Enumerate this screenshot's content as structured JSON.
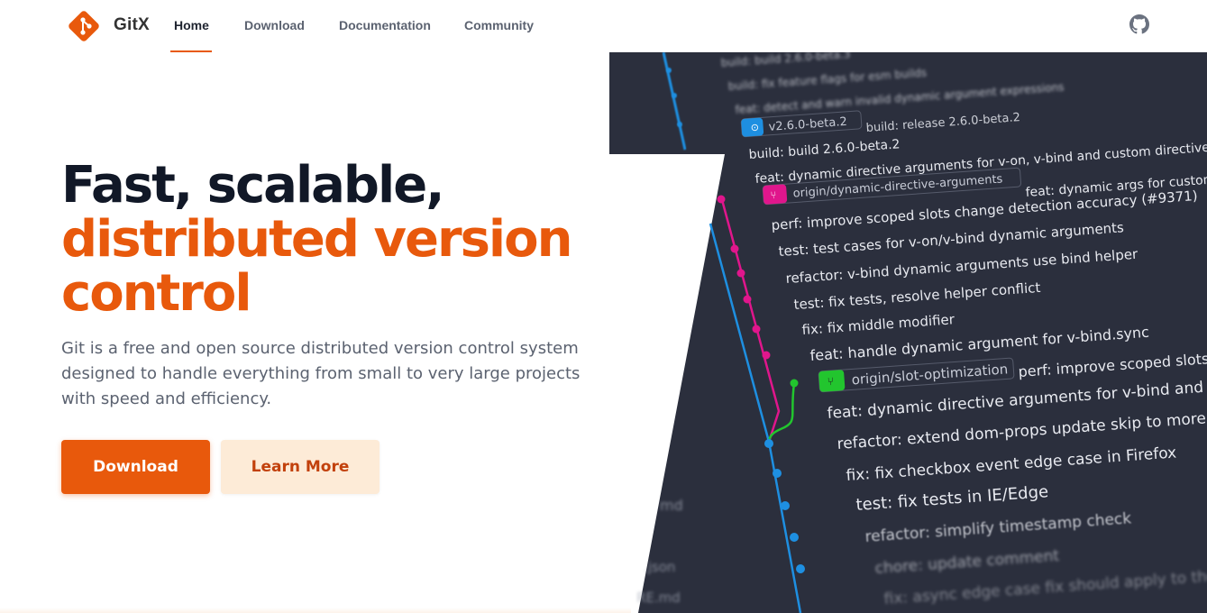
{
  "header": {
    "brand": "GitX",
    "nav": [
      {
        "label": "Home",
        "active": true
      },
      {
        "label": "Download"
      },
      {
        "label": "Documentation"
      },
      {
        "label": "Community"
      }
    ],
    "github_icon": "github-icon",
    "logo_icon": "git-logo-icon"
  },
  "hero": {
    "title_line1": "Fast, scalable,",
    "title_line2": "distributed version",
    "title_line3": "control",
    "description": "Git is a free and open source distributed version control system designed to handle everything from small to very large projects with speed and efficiency.",
    "primary_button": "Download",
    "secondary_button": "Learn More"
  },
  "graph": {
    "commits": [
      {
        "text": "build: build 2.6.0-beta.3"
      },
      {
        "text": "build: fix feature flags for esm builds"
      },
      {
        "text": "feat: detect and warn invalid dynamic argument expressions"
      },
      {
        "text": "build: release 2.6.0-beta.2",
        "tag": "v2.6.0-beta.2"
      },
      {
        "text": "build: build 2.6.0-beta.2"
      },
      {
        "text": "feat: dynamic directive arguments for v-on, v-bind and custom directives"
      },
      {
        "text": "feat: dynamic args for custom",
        "tag": "origin/dynamic-directive-arguments"
      },
      {
        "text": "perf: improve scoped slots change detection accuracy (#9371)"
      },
      {
        "text": "test: test cases for v-on/v-bind dynamic arguments"
      },
      {
        "text": "refactor: v-bind dynamic arguments use bind helper"
      },
      {
        "text": "test: fix tests, resolve helper conflict"
      },
      {
        "text": "fix: fix middle modifier"
      },
      {
        "text": "feat: handle dynamic argument for v-bind.sync"
      },
      {
        "text": "perf: improve scoped slots c",
        "tag": "origin/slot-optimization"
      },
      {
        "text": "feat: dynamic directive arguments for v-bind and v-on"
      },
      {
        "text": "refactor: extend dom-props update skip to more all k"
      },
      {
        "text": "fix: fix checkbox event edge case in Firefox"
      },
      {
        "text": "test: fix tests in IE/Edge"
      },
      {
        "text": "refactor: simplify timestamp check"
      },
      {
        "text": "chore: update comment"
      },
      {
        "text": "fix: async edge case fix should apply to the"
      }
    ],
    "side_fragments": [
      "md",
      ".json",
      "RE.md"
    ],
    "colors": {
      "bg": "#2b2f3d",
      "blue": "#1e8fe1",
      "pink": "#e0168c",
      "green": "#22c52e",
      "text": "#e8eaf0"
    }
  }
}
